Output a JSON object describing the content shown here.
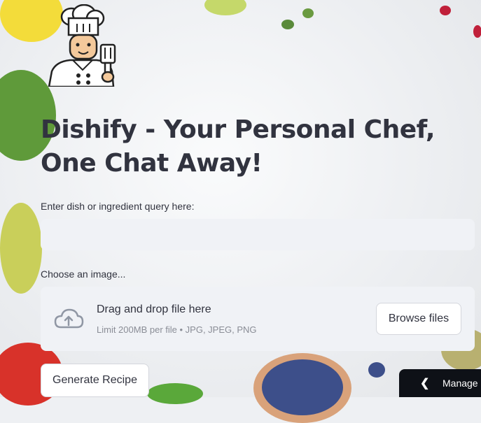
{
  "app": {
    "title": "Dishify - Your Personal Chef, One Chat Away!",
    "logo_icon": "chef-icon"
  },
  "query": {
    "label": "Enter dish or ingredient query here:",
    "value": "",
    "placeholder": ""
  },
  "uploader": {
    "label": "Choose an image...",
    "drag_text": "Drag and drop file here",
    "limit_text": "Limit 200MB per file • JPG, JPEG, PNG",
    "browse_label": "Browse files",
    "icon": "cloud-upload-icon"
  },
  "actions": {
    "generate_label": "Generate Recipe"
  },
  "manage": {
    "label": "Manage",
    "icon": "chevron-left-icon"
  },
  "colors": {
    "text": "#31333f",
    "input_bg": "#f0f2f6",
    "manage_bg": "#0e1117"
  }
}
